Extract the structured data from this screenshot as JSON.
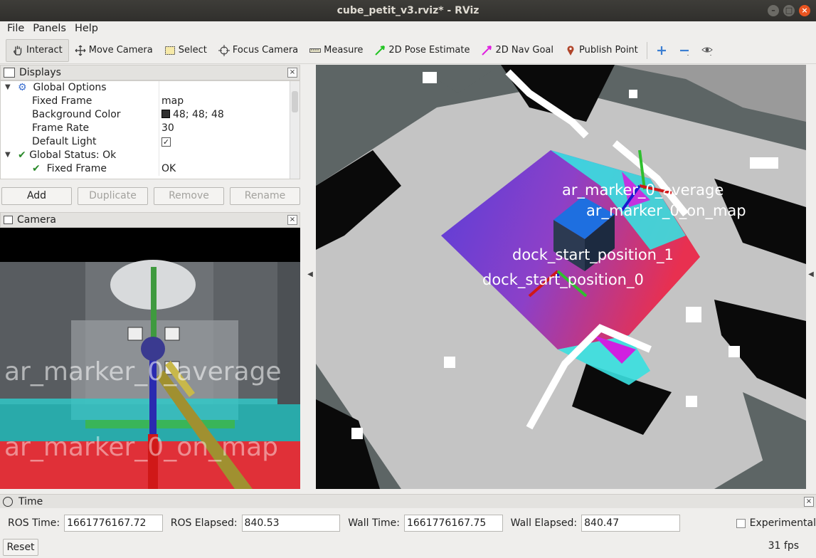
{
  "window": {
    "title": "cube_petit_v3.rviz* - RViz"
  },
  "menu": {
    "file": "File",
    "panels": "Panels",
    "help": "Help"
  },
  "toolbar": {
    "interact": "Interact",
    "move_camera": "Move Camera",
    "select": "Select",
    "focus_camera": "Focus Camera",
    "measure": "Measure",
    "pose_estimate": "2D Pose Estimate",
    "nav_goal": "2D Nav Goal",
    "publish_point": "Publish Point"
  },
  "displays": {
    "title": "Displays",
    "rows": [
      {
        "key": "Global Options",
        "value": ""
      },
      {
        "key": "Fixed Frame",
        "value": "map"
      },
      {
        "key": "Background Color",
        "value": "48; 48; 48"
      },
      {
        "key": "Frame Rate",
        "value": "30"
      },
      {
        "key": "Default Light",
        "value": "✓"
      },
      {
        "key": "Global Status: Ok",
        "value": ""
      },
      {
        "key": "Fixed Frame",
        "value": "OK"
      }
    ],
    "buttons": {
      "add": "Add",
      "duplicate": "Duplicate",
      "remove": "Remove",
      "rename": "Rename"
    }
  },
  "camera": {
    "title": "Camera",
    "overlay_1": "ar_marker_0_average",
    "overlay_2": "ar_marker_0_on_map"
  },
  "view3d": {
    "label_marker": "ar_marker_0_average",
    "label_on_map": "ar_marker_0_on_map",
    "label_dock1": "dock_start_position_1",
    "label_dock0": "dock_start_position_0"
  },
  "time": {
    "title": "Time",
    "ros_time_label": "ROS Time:",
    "ros_time": "1661776167.72",
    "ros_elapsed_label": "ROS Elapsed:",
    "ros_elapsed": "840.53",
    "wall_time_label": "Wall Time:",
    "wall_time": "1661776167.75",
    "wall_elapsed_label": "Wall Elapsed:",
    "wall_elapsed": "840.47",
    "experimental": "Experimental",
    "reset": "Reset",
    "fps": "31 fps"
  },
  "colors": {
    "accent": "#e95420",
    "background": "#303030"
  }
}
